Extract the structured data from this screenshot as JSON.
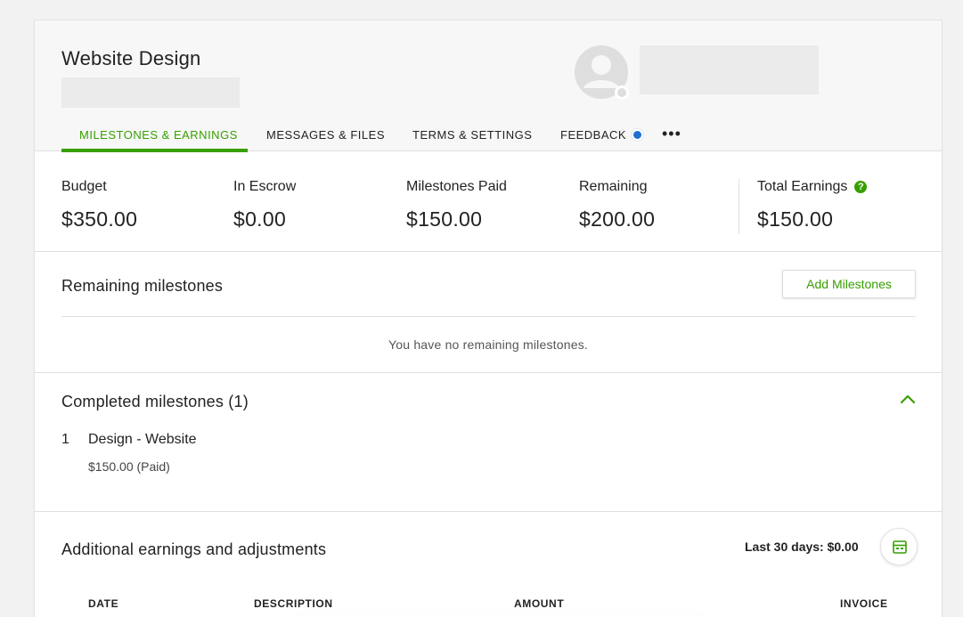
{
  "header": {
    "title": "Website Design",
    "tabs": [
      {
        "label": "MILESTONES & EARNINGS",
        "active": true
      },
      {
        "label": "MESSAGES & FILES",
        "active": false
      },
      {
        "label": "TERMS & SETTINGS",
        "active": false
      },
      {
        "label": "FEEDBACK",
        "active": false
      }
    ],
    "more_label": "•••"
  },
  "stats": {
    "budget": {
      "label": "Budget",
      "value": "$350.00"
    },
    "escrow": {
      "label": "In Escrow",
      "value": "$0.00"
    },
    "paid": {
      "label": "Milestones Paid",
      "value": "$150.00"
    },
    "remaining": {
      "label": "Remaining",
      "value": "$200.00"
    },
    "total": {
      "label": "Total Earnings",
      "value": "$150.00",
      "help_icon": "?"
    }
  },
  "remaining_section": {
    "title": "Remaining milestones",
    "add_button": "Add Milestones",
    "empty_message": "You have no remaining milestones."
  },
  "completed_section": {
    "title": "Completed milestones (1)",
    "items": [
      {
        "number": "1",
        "name": "Design - Website",
        "amount": "$150.00 (Paid)"
      }
    ]
  },
  "additional_section": {
    "title": "Additional earnings and adjustments",
    "last30": "Last 30 days: $0.00",
    "columns": [
      "DATE",
      "DESCRIPTION",
      "AMOUNT",
      "INVOICE"
    ]
  },
  "colors": {
    "accent": "#37a000",
    "notification": "#1f6fd0",
    "header_bg": "#f7f7f7"
  },
  "icons": [
    "avatar-icon",
    "notification-dot-icon",
    "more-icon",
    "help-icon",
    "chevron-up-icon",
    "calendar-icon"
  ]
}
